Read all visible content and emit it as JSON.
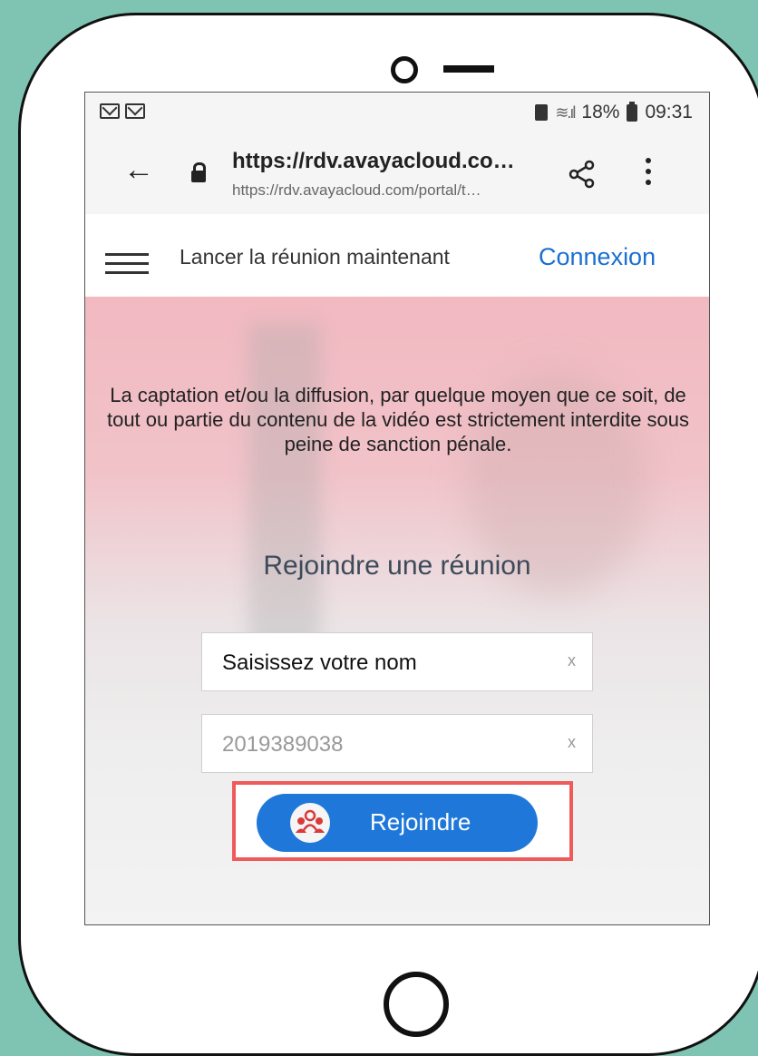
{
  "status_bar": {
    "battery_percent": "18%",
    "time": "09:31"
  },
  "browser": {
    "url_title": "https://rdv.avayacloud.co…",
    "url_full": "https://rdv.avayacloud.com/portal/t…"
  },
  "nav": {
    "launch_meeting": "Lancer la réunion maintenant",
    "login": "Connexion"
  },
  "notice": "La captation et/ou la diffusion, par quelque moyen que ce soit, de tout ou partie du contenu de la vidéo est strictement interdite sous peine de sanction pénale.",
  "join": {
    "title": "Rejoindre une réunion",
    "name_value": "Saisissez votre nom",
    "meeting_id_value": "2019389038",
    "clear_glyph": "x",
    "button_label": "Rejoindre"
  },
  "colors": {
    "primary": "#1f78d9",
    "highlight": "#ef5b5b",
    "link": "#1a6fd1",
    "background": "#7fc4b2"
  }
}
